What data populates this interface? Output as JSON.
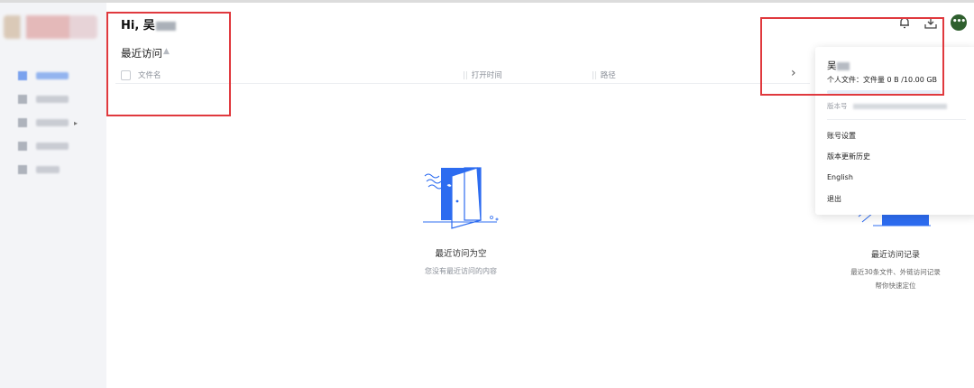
{
  "header": {
    "greeting": "Hi, 吴",
    "section_title": "最近访问",
    "section_icon": "pin-icon"
  },
  "sidebar": {
    "items": [
      {
        "icon": "files-icon",
        "active": true
      },
      {
        "icon": "recent-icon",
        "active": false
      },
      {
        "icon": "shared-icon",
        "active": false,
        "expandable": true
      },
      {
        "icon": "team-icon",
        "active": false
      },
      {
        "icon": "trash-icon",
        "active": false
      }
    ]
  },
  "table": {
    "columns": [
      "文件名",
      "打开时间",
      "路径"
    ]
  },
  "empty_state": {
    "title": "最近访问为空",
    "subtitle": "您没有最近访问的内容"
  },
  "feature_tip": {
    "title": "最近访问记录",
    "line1": "最近30条文件、外链访问记录",
    "line2": "帮你快速定位"
  },
  "toolbar": {
    "notifications_icon": "bell-icon",
    "download_icon": "download-icon",
    "avatar_text": "•••"
  },
  "user_menu": {
    "name": "吴",
    "storage_text": "个人文件：文件量 0 B /10.00 GB",
    "storage_used_fraction": 0.0,
    "version_label": "版本号",
    "items": [
      "账号设置",
      "版本更新历史",
      "English",
      "退出"
    ]
  },
  "colors": {
    "accent": "#2d6cf0",
    "annotation": "#e0393e",
    "avatar_bg": "#2f5f2e"
  }
}
